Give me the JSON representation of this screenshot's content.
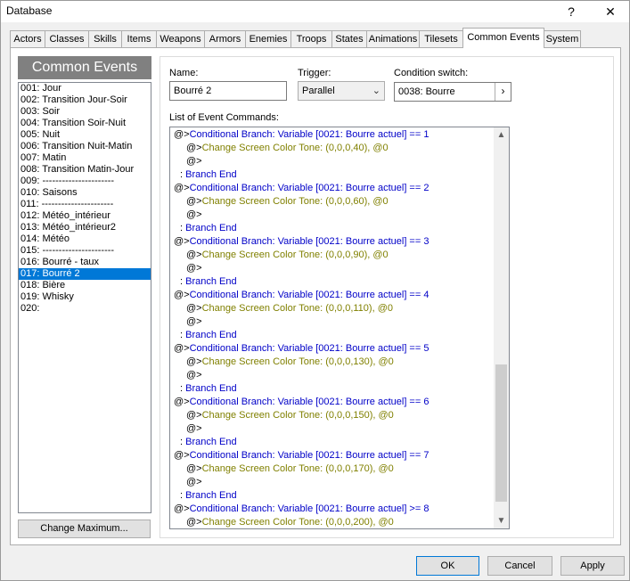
{
  "window": {
    "title": "Database",
    "help_label": "?",
    "close_label": "✕"
  },
  "tabs": [
    "Actors",
    "Classes",
    "Skills",
    "Items",
    "Weapons",
    "Armors",
    "Enemies",
    "Troops",
    "States",
    "Animations",
    "Tilesets",
    "Common Events",
    "System"
  ],
  "active_tab": "Common Events",
  "sidebar": {
    "header": "Common Events",
    "items": [
      "001: Jour",
      "002: Transition Jour-Soir",
      "003: Soir",
      "004: Transition Soir-Nuit",
      "005: Nuit",
      "006: Transition Nuit-Matin",
      "007: Matin",
      "008: Transition Matin-Jour",
      "009: ----------------------",
      "010: Saisons",
      "011: ----------------------",
      "012: Météo_intérieur",
      "013: Météo_intérieur2",
      "014: Météo",
      "015: ----------------------",
      "016: Bourré - taux",
      "017: Bourré 2",
      "018: Bière",
      "019: Whisky",
      "020:"
    ],
    "selected_index": 16,
    "change_max_label": "Change Maximum..."
  },
  "form": {
    "name_label": "Name:",
    "name_value": "Bourré 2",
    "trigger_label": "Trigger:",
    "trigger_value": "Parallel",
    "condition_label": "Condition switch:",
    "condition_value": "0038: Bourre",
    "list_label": "List of Event Commands:"
  },
  "commands": [
    {
      "prefix": "@>",
      "text": "Conditional Branch: Variable [0021: Bourre actuel] == 1",
      "color": "blue",
      "indent": 0
    },
    {
      "prefix": "@>",
      "text": "Change Screen Color Tone: (0,0,0,40), @0",
      "color": "olive",
      "indent": 1
    },
    {
      "prefix": "@>",
      "text": "",
      "color": "black",
      "indent": 1
    },
    {
      "prefix": ": ",
      "text": "Branch End",
      "color": "blue",
      "indent": 0.5
    },
    {
      "prefix": "@>",
      "text": "Conditional Branch: Variable [0021: Bourre actuel] == 2",
      "color": "blue",
      "indent": 0
    },
    {
      "prefix": "@>",
      "text": "Change Screen Color Tone: (0,0,0,60), @0",
      "color": "olive",
      "indent": 1
    },
    {
      "prefix": "@>",
      "text": "",
      "color": "black",
      "indent": 1
    },
    {
      "prefix": ": ",
      "text": "Branch End",
      "color": "blue",
      "indent": 0.5
    },
    {
      "prefix": "@>",
      "text": "Conditional Branch: Variable [0021: Bourre actuel] == 3",
      "color": "blue",
      "indent": 0
    },
    {
      "prefix": "@>",
      "text": "Change Screen Color Tone: (0,0,0,90), @0",
      "color": "olive",
      "indent": 1
    },
    {
      "prefix": "@>",
      "text": "",
      "color": "black",
      "indent": 1
    },
    {
      "prefix": ": ",
      "text": "Branch End",
      "color": "blue",
      "indent": 0.5
    },
    {
      "prefix": "@>",
      "text": "Conditional Branch: Variable [0021: Bourre actuel] == 4",
      "color": "blue",
      "indent": 0
    },
    {
      "prefix": "@>",
      "text": "Change Screen Color Tone: (0,0,0,110), @0",
      "color": "olive",
      "indent": 1
    },
    {
      "prefix": "@>",
      "text": "",
      "color": "black",
      "indent": 1
    },
    {
      "prefix": ": ",
      "text": "Branch End",
      "color": "blue",
      "indent": 0.5
    },
    {
      "prefix": "@>",
      "text": "Conditional Branch: Variable [0021: Bourre actuel] == 5",
      "color": "blue",
      "indent": 0
    },
    {
      "prefix": "@>",
      "text": "Change Screen Color Tone: (0,0,0,130), @0",
      "color": "olive",
      "indent": 1
    },
    {
      "prefix": "@>",
      "text": "",
      "color": "black",
      "indent": 1
    },
    {
      "prefix": ": ",
      "text": "Branch End",
      "color": "blue",
      "indent": 0.5
    },
    {
      "prefix": "@>",
      "text": "Conditional Branch: Variable [0021: Bourre actuel] == 6",
      "color": "blue",
      "indent": 0
    },
    {
      "prefix": "@>",
      "text": "Change Screen Color Tone: (0,0,0,150), @0",
      "color": "olive",
      "indent": 1
    },
    {
      "prefix": "@>",
      "text": "",
      "color": "black",
      "indent": 1
    },
    {
      "prefix": ": ",
      "text": "Branch End",
      "color": "blue",
      "indent": 0.5
    },
    {
      "prefix": "@>",
      "text": "Conditional Branch: Variable [0021: Bourre actuel] == 7",
      "color": "blue",
      "indent": 0
    },
    {
      "prefix": "@>",
      "text": "Change Screen Color Tone: (0,0,0,170), @0",
      "color": "olive",
      "indent": 1
    },
    {
      "prefix": "@>",
      "text": "",
      "color": "black",
      "indent": 1
    },
    {
      "prefix": ": ",
      "text": "Branch End",
      "color": "blue",
      "indent": 0.5
    },
    {
      "prefix": "@>",
      "text": "Conditional Branch: Variable [0021: Bourre actuel] >= 8",
      "color": "blue",
      "indent": 0
    },
    {
      "prefix": "@>",
      "text": "Change Screen Color Tone: (0,0,0,200), @0",
      "color": "olive",
      "indent": 1
    }
  ],
  "colors": {
    "selection": "#0078d7",
    "branch_blue": "#0000c8",
    "tone_olive": "#808000",
    "header_gray": "#808080"
  },
  "footer": {
    "ok_label": "OK",
    "cancel_label": "Cancel",
    "apply_label": "Apply"
  }
}
